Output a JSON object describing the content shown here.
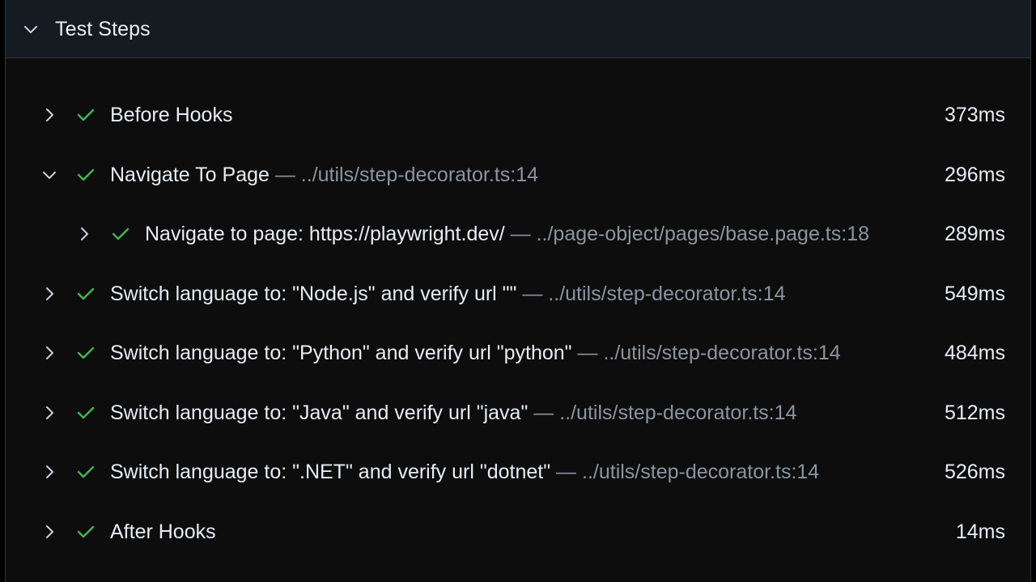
{
  "section": {
    "title": "Test Steps",
    "expanded": true
  },
  "colors": {
    "pass": "#3fb950",
    "text": "#e6edf3",
    "muted": "#8b949e",
    "panel_bg": "#0d0d0e",
    "header_bg": "#161b22"
  },
  "steps": [
    {
      "name": "Before Hooks",
      "location": "",
      "duration": "373ms",
      "expanded": false,
      "depth": 0,
      "status": "passed"
    },
    {
      "name": "Navigate To Page",
      "location": " — ../utils/step-decorator.ts:14",
      "duration": "296ms",
      "expanded": true,
      "depth": 0,
      "status": "passed"
    },
    {
      "name": "Navigate to page: https://playwright.dev/",
      "location": " — ../page-object/pages/base.page.ts:18",
      "duration": "289ms",
      "expanded": false,
      "depth": 1,
      "status": "passed"
    },
    {
      "name": "Switch language to: \"Node.js\" and verify url \"\"",
      "location": " — ../utils/step-decorator.ts:14",
      "duration": "549ms",
      "expanded": false,
      "depth": 0,
      "status": "passed"
    },
    {
      "name": "Switch language to: \"Python\" and verify url \"python\"",
      "location": " — ../utils/step-decorator.ts:14",
      "duration": "484ms",
      "expanded": false,
      "depth": 0,
      "status": "passed"
    },
    {
      "name": "Switch language to: \"Java\" and verify url \"java\"",
      "location": " — ../utils/step-decorator.ts:14",
      "duration": "512ms",
      "expanded": false,
      "depth": 0,
      "status": "passed"
    },
    {
      "name": "Switch language to: \".NET\" and verify url \"dotnet\"",
      "location": " — ../utils/step-decorator.ts:14",
      "duration": "526ms",
      "expanded": false,
      "depth": 0,
      "status": "passed"
    },
    {
      "name": "After Hooks",
      "location": "",
      "duration": "14ms",
      "expanded": false,
      "depth": 0,
      "status": "passed"
    }
  ]
}
